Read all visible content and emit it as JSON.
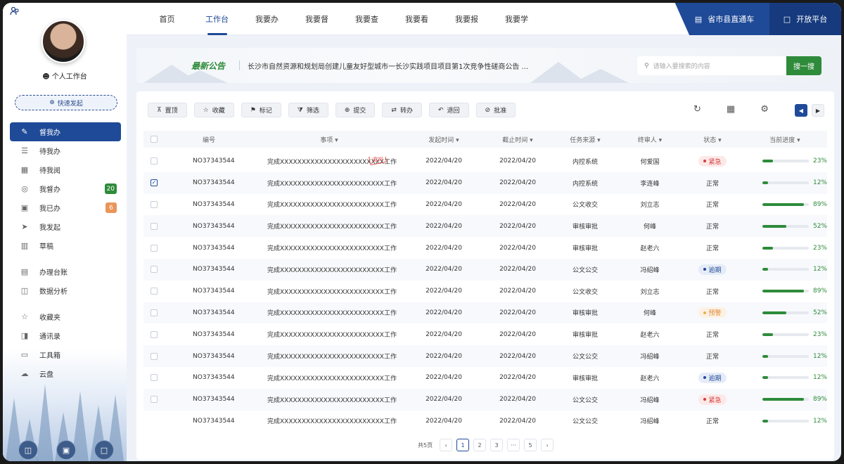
{
  "sidebar": {
    "profile_label": "个人工作台",
    "quick_launch": "快速发起",
    "items": [
      {
        "label": "督我办",
        "icon": "stamp-icon",
        "active": true
      },
      {
        "label": "待我办",
        "icon": "todo-icon"
      },
      {
        "label": "待我阅",
        "icon": "read-icon"
      },
      {
        "label": "我督办",
        "icon": "supervise-icon",
        "badge": "20",
        "badge_color": "#2e8b3a"
      },
      {
        "label": "我已办",
        "icon": "done-icon",
        "badge": "6",
        "badge_color": "#e9965a"
      },
      {
        "label": "我发起",
        "icon": "send-icon"
      },
      {
        "label": "草稿",
        "icon": "trash-icon"
      },
      {
        "label": "办理台账",
        "icon": "ledger-icon"
      },
      {
        "label": "数据分析",
        "icon": "chart-icon"
      },
      {
        "label": "收藏夹",
        "icon": "star-icon"
      },
      {
        "label": "通讯录",
        "icon": "contacts-icon"
      },
      {
        "label": "工具箱",
        "icon": "toolbox-icon"
      },
      {
        "label": "云盘",
        "icon": "cloud-icon"
      }
    ]
  },
  "topnav": {
    "tabs": [
      "首页",
      "工作台",
      "我要办",
      "我要督",
      "我要查",
      "我要看",
      "我要报",
      "我要学"
    ],
    "active_tab": "工作台",
    "right_1": "省市县直通车",
    "right_2": "开放平台"
  },
  "notice": {
    "tag": "最新公告",
    "text": "长沙市自然资源和规划局创建儿童友好型城市一长沙实践项目项目第1次竞争性磋商公告 ...",
    "search_placeholder": "请输入要搜索的内容",
    "search_button": "搜一搜"
  },
  "toolbar": [
    "置顶",
    "收藏",
    "标记",
    "筛选",
    "提交",
    "转办",
    "退回",
    "批准"
  ],
  "table": {
    "headers": [
      "编号",
      "事项",
      "发起时间",
      "截止时间",
      "任务来源",
      "终审人",
      "状态",
      "当前进度"
    ],
    "rows": [
      {
        "no": "NO37343544",
        "task": "完成XXXXXXXXXXXXXXXXXXXXXXXX工作",
        "stamp": "退回",
        "start": "2022/04/20",
        "end": "2022/04/20",
        "source": "内控系统",
        "auditor": "何爱国",
        "status": "紧急",
        "status_type": "urgent",
        "progress": 23
      },
      {
        "no": "NO37343544",
        "task": "完成XXXXXXXXXXXXXXXXXXXXXXXX工作",
        "start": "2022/04/20",
        "end": "2022/04/20",
        "source": "内控系统",
        "auditor": "李连峰",
        "status": "正常",
        "status_type": "normal",
        "progress": 12,
        "checked": true
      },
      {
        "no": "NO37343544",
        "task": "完成XXXXXXXXXXXXXXXXXXXXXXXX工作",
        "start": "2022/04/20",
        "end": "2022/04/20",
        "source": "公文收交",
        "auditor": "刘立志",
        "status": "正常",
        "status_type": "normal",
        "progress": 89
      },
      {
        "no": "NO37343544",
        "task": "完成XXXXXXXXXXXXXXXXXXXXXXXX工作",
        "start": "2022/04/20",
        "end": "2022/04/20",
        "source": "审核审批",
        "auditor": "何峰",
        "status": "正常",
        "status_type": "normal",
        "progress": 52
      },
      {
        "no": "NO37343544",
        "task": "完成XXXXXXXXXXXXXXXXXXXXXXXX工作",
        "start": "2022/04/20",
        "end": "2022/04/20",
        "source": "审核审批",
        "auditor": "赵老六",
        "status": "正常",
        "status_type": "normal",
        "progress": 23
      },
      {
        "no": "NO37343544",
        "task": "完成XXXXXXXXXXXXXXXXXXXXXXXX工作",
        "start": "2022/04/20",
        "end": "2022/04/20",
        "source": "公文公交",
        "auditor": "冯绍峰",
        "status": "逾期",
        "status_type": "overdue",
        "progress": 12
      },
      {
        "no": "NO37343544",
        "task": "完成XXXXXXXXXXXXXXXXXXXXXXXX工作",
        "start": "2022/04/20",
        "end": "2022/04/20",
        "source": "公文收交",
        "auditor": "刘立志",
        "status": "正常",
        "status_type": "normal",
        "progress": 89
      },
      {
        "no": "NO37343544",
        "task": "完成XXXXXXXXXXXXXXXXXXXXXXXX工作",
        "start": "2022/04/20",
        "end": "2022/04/20",
        "source": "审核审批",
        "auditor": "何峰",
        "status": "预警",
        "status_type": "warning",
        "progress": 52
      },
      {
        "no": "NO37343544",
        "task": "完成XXXXXXXXXXXXXXXXXXXXXXXX工作",
        "start": "2022/04/20",
        "end": "2022/04/20",
        "source": "审核审批",
        "auditor": "赵老六",
        "status": "正常",
        "status_type": "normal",
        "progress": 23
      },
      {
        "no": "NO37343544",
        "task": "完成XXXXXXXXXXXXXXXXXXXXXXXX工作",
        "start": "2022/04/20",
        "end": "2022/04/20",
        "source": "公文公交",
        "auditor": "冯绍峰",
        "status": "正常",
        "status_type": "normal",
        "progress": 12
      },
      {
        "no": "NO37343544",
        "task": "完成XXXXXXXXXXXXXXXXXXXXXXXX工作",
        "start": "2022/04/20",
        "end": "2022/04/20",
        "source": "审核审批",
        "auditor": "赵老六",
        "status": "逾期",
        "status_type": "overdue",
        "progress": 12
      },
      {
        "no": "NO37343544",
        "task": "完成XXXXXXXXXXXXXXXXXXXXXXXX工作",
        "start": "2022/04/20",
        "end": "2022/04/20",
        "source": "公文公交",
        "auditor": "冯绍峰",
        "status": "紧急",
        "status_type": "urgent",
        "progress": 89
      },
      {
        "no": "NO37343544",
        "task": "完成XXXXXXXXXXXXXXXXXXXXXXXX工作",
        "start": "2022/04/20",
        "end": "2022/04/20",
        "source": "公文公交",
        "auditor": "冯绍峰",
        "status": "正常",
        "status_type": "normal",
        "progress": 12,
        "no_checkbox": true
      }
    ]
  },
  "pagination": {
    "total": "共5页",
    "pages": [
      "1",
      "2",
      "3",
      "···",
      "5"
    ],
    "current": "1"
  },
  "colors": {
    "primary": "#1f4a98",
    "green": "#2e8b3a",
    "urgent": "#e04848",
    "overdue": "#1f4a98",
    "warning": "#e9965a"
  }
}
